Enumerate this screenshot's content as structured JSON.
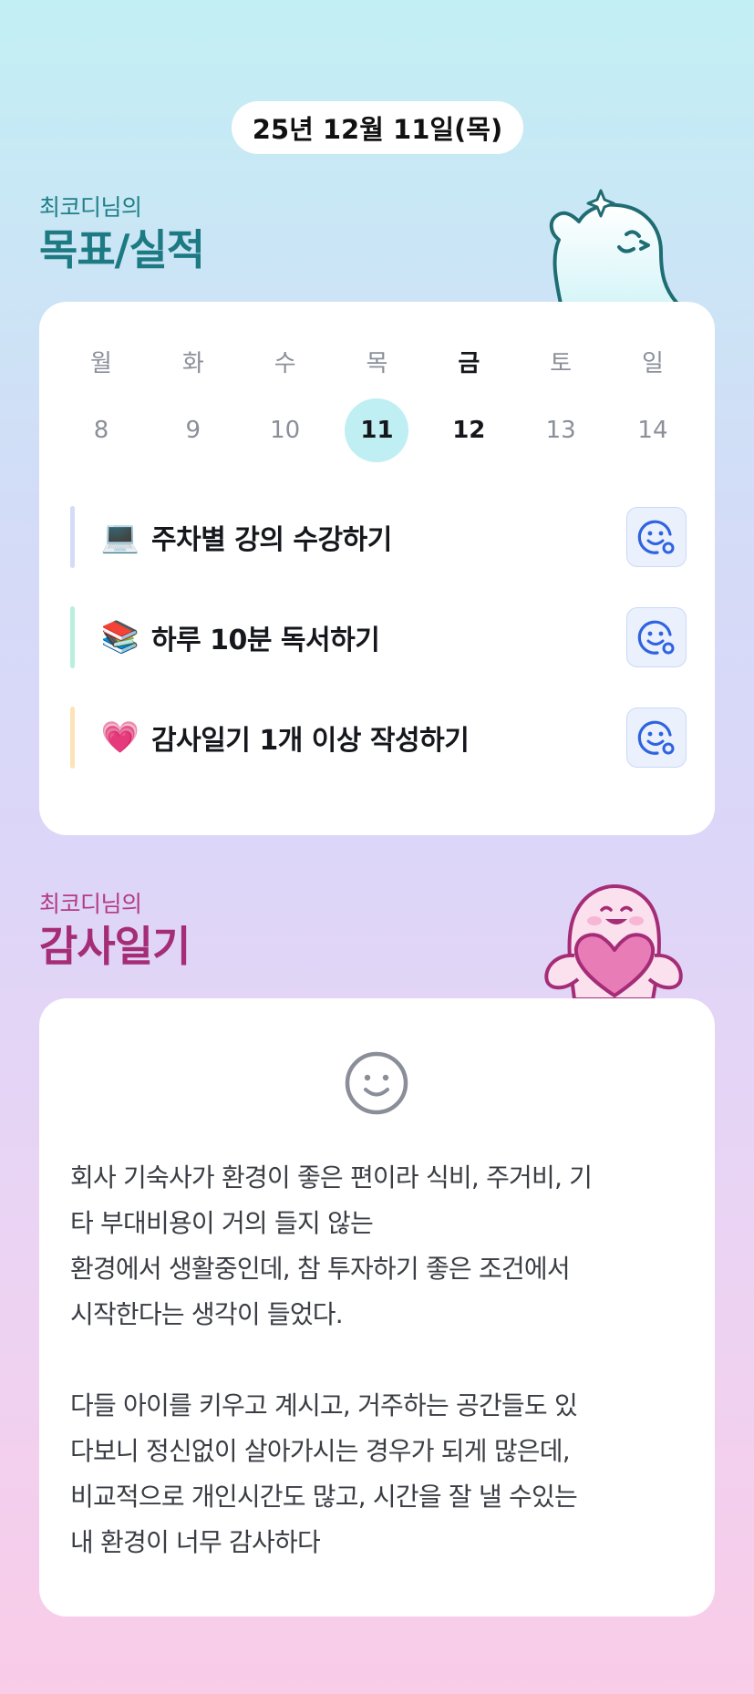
{
  "date": "25년 12월 11일(목)",
  "goals_section": {
    "subtitle": "최코디님의",
    "title": "목표/실적"
  },
  "week": {
    "days": [
      {
        "name": "월",
        "num": "8"
      },
      {
        "name": "화",
        "num": "9"
      },
      {
        "name": "수",
        "num": "10"
      },
      {
        "name": "목",
        "num": "11"
      },
      {
        "name": "금",
        "num": "12"
      },
      {
        "name": "토",
        "num": "13"
      },
      {
        "name": "일",
        "num": "14"
      }
    ]
  },
  "goals": [
    {
      "emoji": "💻",
      "text": "주차별 강의 수강하기",
      "bar_color": "#d4dcf6"
    },
    {
      "emoji": "📚",
      "text": "하루 10분 독서하기",
      "bar_color": "#b9efdd"
    },
    {
      "emoji": "💗",
      "text": "감사일기 1개 이상 작성하기",
      "bar_color": "#fde3b8"
    }
  ],
  "gratitude_section": {
    "subtitle": "최코디님의",
    "title": "감사일기"
  },
  "gratitude": {
    "body": "회사 기숙사가 환경이 좋은 편이라 식비, 주거비, 기\n타 부대비용이 거의 들지 않는\n환경에서 생활중인데, 참 투자하기 좋은 조건에서\n시작한다는 생각이 들었다.\n\n다들 아이를 키우고 계시고, 거주하는 공간들도 있\n다보니 정신없이 살아가시는 경우가 되게 많은데,\n비교적으로 개인시간도 많고, 시간을 잘 낼 수있는\n내 환경이 너무 감사하다"
  },
  "colors": {
    "accent_teal": "#1d7a83",
    "accent_pink": "#a52d78",
    "today_highlight": "#bfeef3",
    "button_blue": "#2f63e0"
  },
  "icons": {
    "goal_button": "smile-check-icon",
    "gratitude_mood": "smile-icon"
  }
}
